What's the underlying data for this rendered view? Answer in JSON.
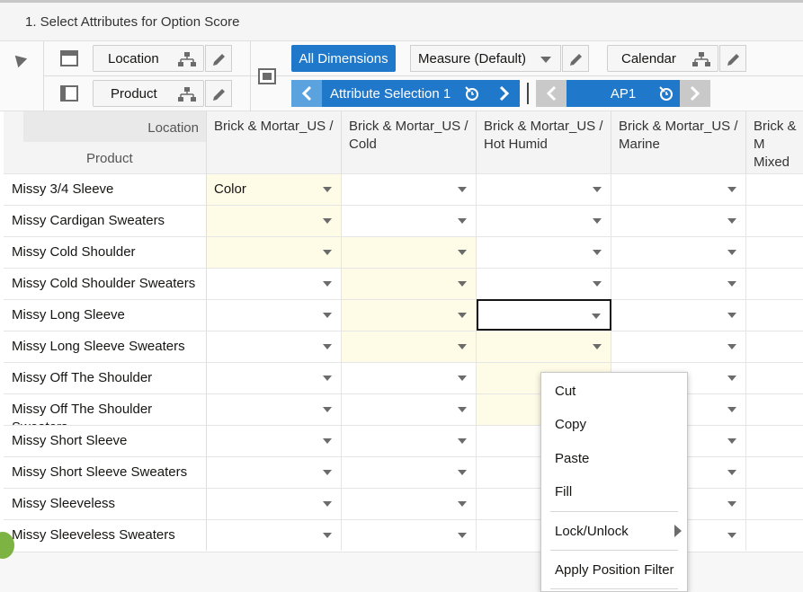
{
  "title": "1. Select Attributes for Option Score",
  "toolbar": {
    "location_label": "Location",
    "product_label": "Product",
    "all_dimensions_label": "All Dimensions",
    "measure_label": "Measure (Default)",
    "calendar_label": "Calendar",
    "attribute_selection_label": "Attribute Selection 1",
    "ap_label": "AP1"
  },
  "grid": {
    "corner_location": "Location",
    "corner_product": "Product",
    "columns": [
      {
        "line1": "Brick & Mortar_US /",
        "line2": ""
      },
      {
        "line1": "Brick & Mortar_US /",
        "line2": "Cold"
      },
      {
        "line1": "Brick & Mortar_US /",
        "line2": "Hot Humid"
      },
      {
        "line1": "Brick & Mortar_US /",
        "line2": "Marine"
      },
      {
        "line1": "Brick & M",
        "line2": "Mixed D"
      }
    ],
    "rows": [
      {
        "label": "Missy 3/4 Sleeve",
        "first_value": "Color"
      },
      {
        "label": "Missy Cardigan Sweaters",
        "first_value": ""
      },
      {
        "label": "Missy Cold Shoulder",
        "first_value": ""
      },
      {
        "label": "Missy Cold Shoulder Sweaters",
        "first_value": ""
      },
      {
        "label": "Missy Long Sleeve",
        "first_value": ""
      },
      {
        "label": "Missy Long Sleeve Sweaters",
        "first_value": ""
      },
      {
        "label": "Missy Off The Shoulder",
        "first_value": ""
      },
      {
        "label": "Missy Off The Shoulder Sweaters",
        "first_value": ""
      },
      {
        "label": "Missy Short Sleeve",
        "first_value": ""
      },
      {
        "label": "Missy Short Sleeve Sweaters",
        "first_value": ""
      },
      {
        "label": "Missy Sleeveless",
        "first_value": ""
      },
      {
        "label": "Missy Sleeveless Sweaters",
        "first_value": ""
      }
    ]
  },
  "context_menu": {
    "cut": "Cut",
    "copy": "Copy",
    "paste": "Paste",
    "fill": "Fill",
    "lock_unlock": "Lock/Unlock",
    "apply_position_filter": "Apply Position Filter"
  },
  "colors": {
    "accent": "#1f78c9",
    "accent_light": "#5aa3de",
    "highlight_cell": "#fefbe6"
  }
}
